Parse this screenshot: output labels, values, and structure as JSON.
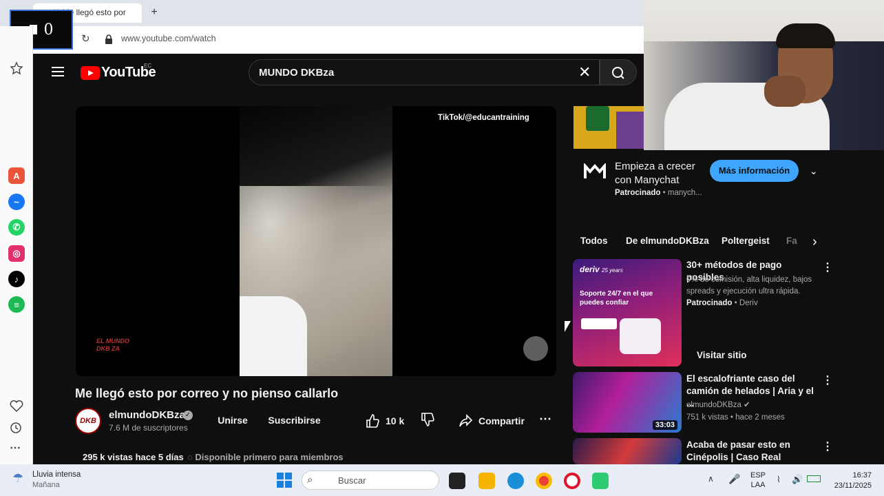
{
  "browser": {
    "tab_title": "( ) Me llegó esto por",
    "new_tab_label": "+",
    "url": "www.youtube.com/watch",
    "overlay_counter": "0"
  },
  "sidebar": {
    "icons": [
      "aria-icon",
      "messenger-icon",
      "whatsapp-icon",
      "instagram-icon",
      "tiktok-icon",
      "spotify-icon"
    ],
    "colors": [
      "#e9543a",
      "#1877f2",
      "#25d366",
      "#e1306c",
      "#000000",
      "#1db954"
    ]
  },
  "youtube": {
    "logo_text": "YouTube",
    "region": "EC",
    "search_value": "MUNDO DKBza",
    "video": {
      "overlay_credit": "TikTok/@educantraining",
      "watermark": "EL MUNDO DKB ZA",
      "title": "Me llegó esto por correo y no pienso callarlo",
      "channel_name": "elmundoDKBza",
      "channel_avatar": "DKB",
      "subscribers": "7.6 M de suscriptores",
      "join_label": "Unirse",
      "subscribe_label": "Suscribirse",
      "likes": "10 k",
      "share_label": "Compartir",
      "views": "295 k vistas  hace 5 días",
      "members_note": "Disponible primero para miembros"
    },
    "ad": {
      "title": "Empieza a crecer con Manychat",
      "sponsored": "Patrocinado",
      "advertiser": "manych...",
      "cta": "Más información"
    },
    "chips": [
      "Todos",
      "De elmundoDKBza",
      "Poltergeist",
      "Fa"
    ],
    "related": [
      {
        "title": "30+ métodos de pago posibles",
        "meta1": "0% de comisión, alta liquidez, bajos spreads y ejecución ultra rápida.",
        "meta2": "Patrocinado",
        "meta3": "Deriv",
        "thumb_brand": "deriv",
        "thumb_years": "25 years",
        "thumb_text": "Soporte 24/7 en el que puedes confiar",
        "visit_label": "Visitar sitio"
      },
      {
        "title": "El escalofriante caso del camión de helados | Aria y el ...",
        "channel": "elmundoDKBza",
        "meta": "751 k vistas • hace 2 meses",
        "duration": "33:03"
      },
      {
        "title": "Acaba de pasar esto en Cinépolis | Caso Real"
      }
    ]
  },
  "taskbar": {
    "weather_title": "Lluvia intensa",
    "weather_sub": "Mañana",
    "search_placeholder": "Buscar",
    "lang1": "ESP",
    "lang2": "LAA",
    "time": "16:37",
    "date": "23/11/2025"
  }
}
